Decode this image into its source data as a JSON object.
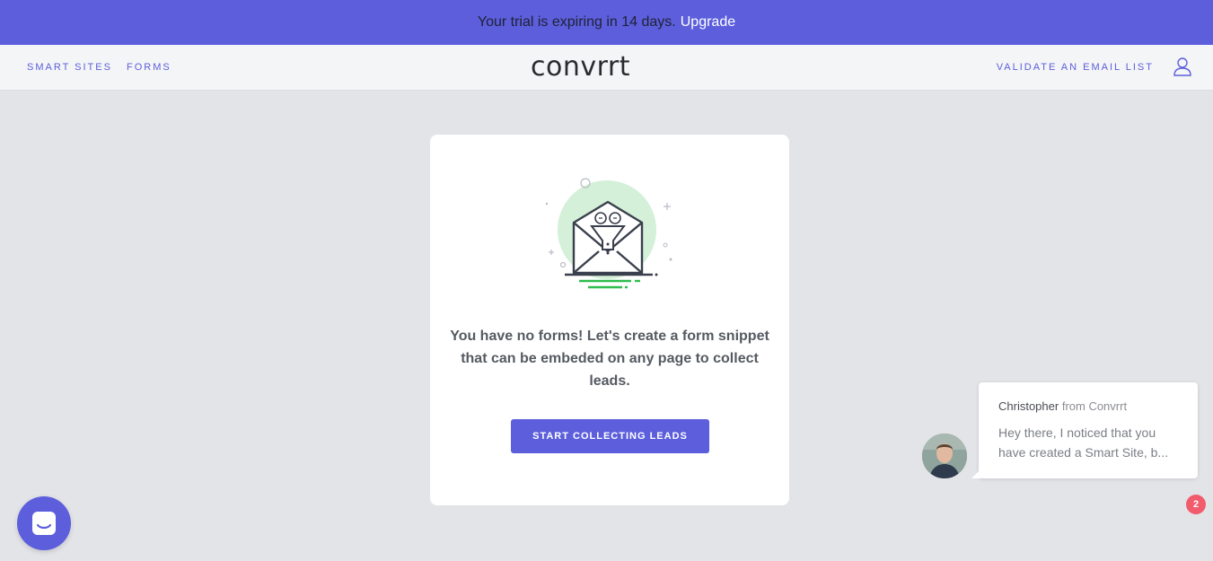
{
  "banner": {
    "message": "Your trial is expiring in 14 days.",
    "upgrade_label": "Upgrade"
  },
  "nav": {
    "smart_sites": "SMART SITES",
    "forms": "FORMS",
    "logo": "convrrt",
    "validate": "VALIDATE AN EMAIL LIST"
  },
  "empty_state": {
    "message": "You have no forms! Let's create a form snippet that can be embeded on any page to collect leads.",
    "cta_label": "START COLLECTING LEADS"
  },
  "chat": {
    "agent_name": "Christopher",
    "from_text": "from Convrrt",
    "preview": "Hey there, I noticed that you have created a Smart Site, b...",
    "unread_count": "2"
  },
  "icons": {
    "user": "user-icon",
    "envelope": "envelope-funnel-icon",
    "launcher": "chat-launcher-icon"
  },
  "colors": {
    "accent": "#5c5edc",
    "banner_bg": "#5c5edc",
    "page_bg": "#e3e4e8",
    "badge": "#f15b6c",
    "illustration_circle": "#d4f0d8",
    "illustration_lines": "#2ebd4e"
  }
}
